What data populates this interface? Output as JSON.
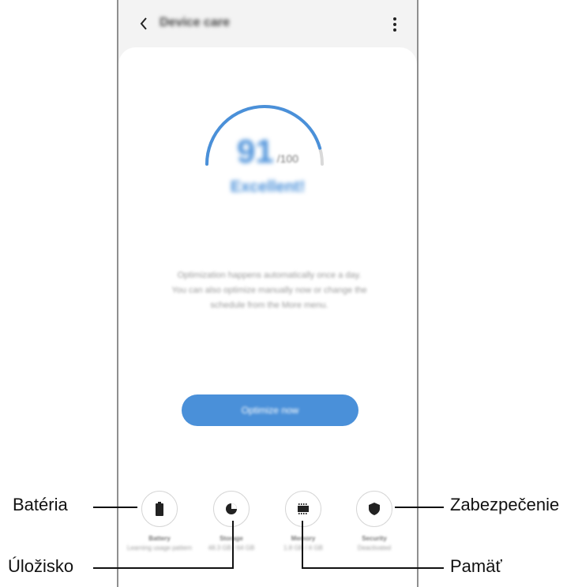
{
  "app_bar": {
    "title": "Device care"
  },
  "score": {
    "value": 91,
    "max_label": "/100",
    "gauge_fraction": 0.91,
    "status": "Excellent!"
  },
  "description": {
    "line1": "Optimization happens automatically once a day.",
    "line2": "You can also optimize manually now or change the",
    "line3": "schedule from the More menu."
  },
  "optimize_button": {
    "label": "Optimize now"
  },
  "categories": [
    {
      "name": "Battery",
      "sub": "Learning usage pattern"
    },
    {
      "name": "Storage",
      "sub": "48.3 GB / 64 GB"
    },
    {
      "name": "Memory",
      "sub": "1.8 GB / 4 GB"
    },
    {
      "name": "Security",
      "sub": "Deactivated"
    }
  ],
  "callouts": {
    "battery": "Batéria",
    "storage": "Úložisko",
    "security": "Zabezpečenie",
    "memory": "Pamäť"
  },
  "colors": {
    "accent": "#4a90d9",
    "gauge_track": "#d9d9d9"
  }
}
